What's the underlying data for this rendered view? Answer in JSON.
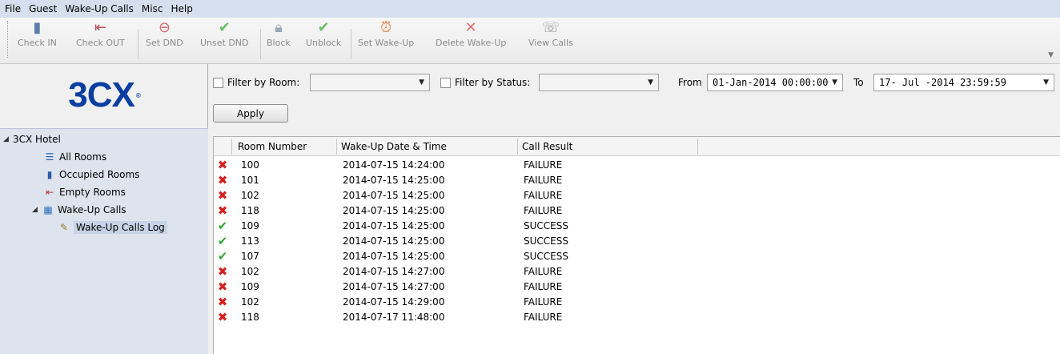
{
  "menu": [
    "File",
    "Guest",
    "Wake-Up Calls",
    "Misc",
    "Help"
  ],
  "toolbar": [
    {
      "label": "Check IN",
      "icon": "check-in-icon"
    },
    {
      "label": "Check OUT",
      "icon": "check-out-icon"
    },
    {
      "label": "Set DND",
      "icon": "dnd-icon"
    },
    {
      "label": "Unset DND",
      "icon": "checkmark-icon"
    },
    {
      "label": "Block",
      "icon": "lock-icon"
    },
    {
      "label": "Unblock",
      "icon": "checkmark-icon"
    },
    {
      "label": "Set Wake-Up",
      "icon": "alarm-clock-icon"
    },
    {
      "label": "Delete Wake-Up",
      "icon": "x-icon"
    },
    {
      "label": "View Calls",
      "icon": "view-calls-icon"
    }
  ],
  "logo": {
    "text": "3CX",
    "mark": "®"
  },
  "tree": {
    "root": "3CX Hotel",
    "all_rooms": "All Rooms",
    "occupied_rooms": "Occupied Rooms",
    "empty_rooms": "Empty Rooms",
    "wakeup_calls": "Wake-Up Calls",
    "wakeup_log": "Wake-Up Calls Log"
  },
  "filters": {
    "room_label": "Filter by Room:",
    "room_value": "",
    "status_label": "Filter by Status:",
    "status_value": "",
    "from_label": "From",
    "from_value": "01-Jan-2014 00:00:00",
    "to_label": "To",
    "to_value": "17- Jul -2014 23:59:59",
    "apply_label": "Apply"
  },
  "grid": {
    "columns": [
      "Room Number",
      "Wake-Up Date & Time",
      "Call Result"
    ],
    "rows": [
      {
        "status": "fail",
        "room": "100",
        "time": "2014-07-15 14:24:00",
        "result": "FAILURE"
      },
      {
        "status": "fail",
        "room": "101",
        "time": "2014-07-15 14:25:00",
        "result": "FAILURE"
      },
      {
        "status": "fail",
        "room": "102",
        "time": "2014-07-15 14:25:00",
        "result": "FAILURE"
      },
      {
        "status": "fail",
        "room": "118",
        "time": "2014-07-15 14:25:00",
        "result": "FAILURE"
      },
      {
        "status": "ok",
        "room": "109",
        "time": "2014-07-15 14:25:00",
        "result": "SUCCESS"
      },
      {
        "status": "ok",
        "room": "113",
        "time": "2014-07-15 14:25:00",
        "result": "SUCCESS"
      },
      {
        "status": "ok",
        "room": "107",
        "time": "2014-07-15 14:25:00",
        "result": "SUCCESS"
      },
      {
        "status": "fail",
        "room": "102",
        "time": "2014-07-15 14:27:00",
        "result": "FAILURE"
      },
      {
        "status": "fail",
        "room": "109",
        "time": "2014-07-15 14:27:00",
        "result": "FAILURE"
      },
      {
        "status": "fail",
        "room": "102",
        "time": "2014-07-15 14:29:00",
        "result": "FAILURE"
      },
      {
        "status": "fail",
        "room": "118",
        "time": "2014-07-17 11:48:00",
        "result": "FAILURE"
      }
    ]
  },
  "colors": {
    "fail": "#d42020",
    "ok": "#2faa2f",
    "logo": "#0a3fa0",
    "menubar": "#d6dfee"
  }
}
